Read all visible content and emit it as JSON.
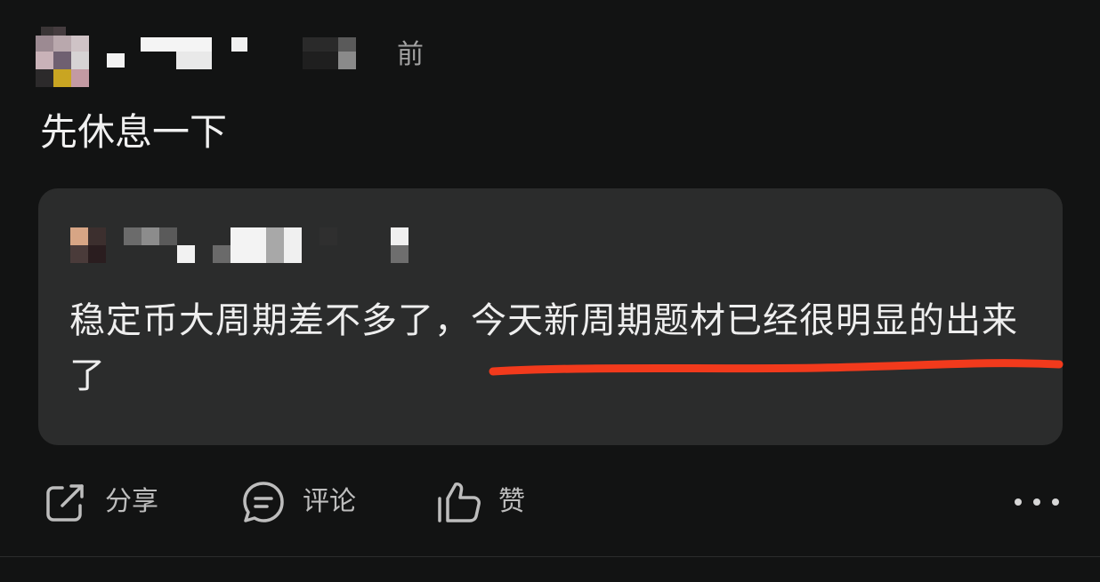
{
  "post": {
    "time_suffix": "前",
    "text": "先休息一下"
  },
  "quote": {
    "text": "稳定币大周期差不多了，今天新周期题材已经很明显的出来了"
  },
  "actions": {
    "share_label": "分享",
    "comment_label": "评论",
    "like_label": "赞"
  },
  "icons": {
    "share": "share-icon",
    "comment": "comment-icon",
    "like": "thumbs-up-icon",
    "more": "more-icon"
  },
  "colors": {
    "background": "#121313",
    "card": "#2b2c2c",
    "underline": "#f23a1c"
  }
}
